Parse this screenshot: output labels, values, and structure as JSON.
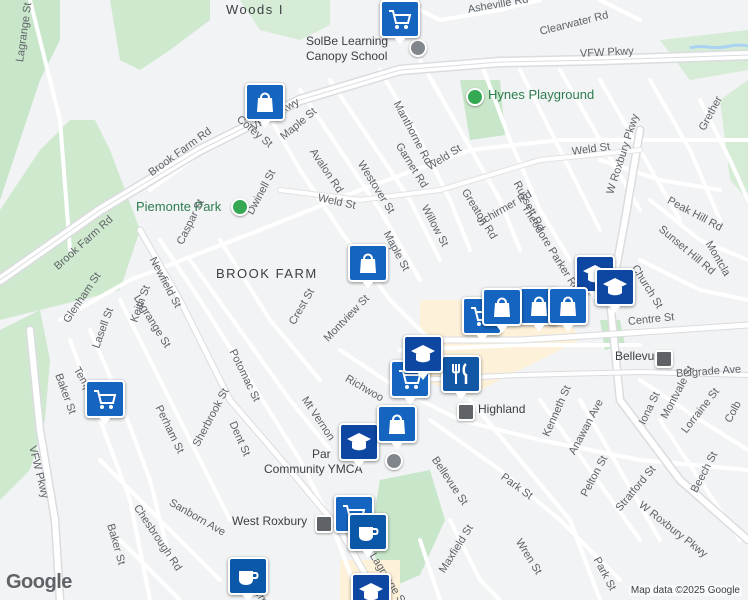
{
  "labels": {
    "areas": [
      "Woods I",
      "BROOK FARM"
    ],
    "parks": [
      "Piemonte Park",
      "Hynes Playground"
    ],
    "pois": [
      "SolBe Learning",
      "Canopy School",
      "Community YMCA",
      "Par"
    ],
    "stations": [
      "Bellevue",
      "Highland",
      "West Roxbury"
    ],
    "streets": {
      "vfw_pkwy_top": "VFW Pkwy",
      "vfw_pkwy_left": "VFW Pkwy",
      "vfw_pkwy_lower": "VFW Pkwy",
      "asheville": "Asheville Rd",
      "clearwater": "Clearwater Rd",
      "grether": "Grether",
      "manthorne": "Manthorne Rd",
      "garnet": "Garnet Rd",
      "westover": "Westover St",
      "weld_left": "Weld St",
      "weld_mid": "Weld St",
      "weld_right": "Weld St",
      "corey": "Corey St",
      "maple_top": "Maple St",
      "avalon": "Avalon Rd",
      "brook_farm_top": "Brook Farm Rd",
      "brook_farm_left": "Brook Farm Rd",
      "lagrange_top": "Lagrange St",
      "lagrange_mid": "Lagrange St",
      "lagrange_bottom": "Lagrange St",
      "dwinell": "Dwinell St",
      "caspar": "Caspar St",
      "newfield": "Newfield St",
      "keith": "Keith St",
      "glenham": "Glenham St",
      "lasell": "Lasell St",
      "temple_left": "Temple St",
      "temple_bottom": "Temple",
      "baker_left": "Baker St",
      "baker_bottom": "Baker St",
      "greaton": "Greaton Rd",
      "russett": "Russett Rd",
      "theodore": "Theodore Parker Rd",
      "w_roxbury_top": "W Roxbury Pkwy",
      "w_roxbury_bottom": "W Roxbury Pkwy",
      "peak_hill": "Peak Hill Rd",
      "sunset_hill": "Sunset Hill Rd",
      "montclair": "Montcla",
      "willow": "Willow St",
      "schirmer": "Schirmer Rd",
      "maple_mid": "Maple St",
      "church": "Church St",
      "centre": "Centre St",
      "belgrade": "Belgrade Ave",
      "crest": "Crest St",
      "montview": "Montview St",
      "potomac": "Potomac St",
      "perham": "Perham St",
      "sherbrook": "Sherbrook St",
      "dent": "Dent St",
      "mt_vernon": "Mt Vernon",
      "richwood": "Richwoo",
      "kenneth": "Kenneth St",
      "anawan": "Anawan Ave",
      "iona": "Iona St",
      "montvale": "Montvale St",
      "lorraine": "Lorraine St",
      "colby": "Colb",
      "bellevue_st": "Bellevue St",
      "park": "Park St",
      "pelton": "Pelton St",
      "stratford": "Stratford St",
      "beech": "Beech St",
      "park_bottom": "Park St",
      "wren": "Wren St",
      "maxfield": "Maxfield St",
      "sanborn": "Sanborn Ave",
      "chesbrough": "Chesbrough Rd"
    }
  },
  "pins": [
    {
      "kind": "shop",
      "icon": "shopping-cart-icon"
    },
    {
      "kind": "shop",
      "icon": "shopping-bag-icon"
    },
    {
      "kind": "shop",
      "icon": "shopping-bag-icon"
    },
    {
      "kind": "shop",
      "icon": "shopping-cart-icon"
    },
    {
      "kind": "edu",
      "icon": "school-icon"
    },
    {
      "kind": "shop",
      "icon": "shopping-bag-icon"
    },
    {
      "kind": "edu",
      "icon": "school-icon"
    },
    {
      "kind": "shop",
      "icon": "shopping-cart-icon"
    },
    {
      "kind": "cafe",
      "icon": "coffee-cup-icon"
    },
    {
      "kind": "cafe",
      "icon": "coffee-cup-icon"
    },
    {
      "kind": "food",
      "icon": "restaurant-icon"
    },
    {
      "kind": "shop",
      "icon": "shopping-cart-icon"
    },
    {
      "kind": "shop",
      "icon": "shopping-bag-icon"
    },
    {
      "kind": "shop",
      "icon": "shopping-bag-icon"
    },
    {
      "kind": "shop",
      "icon": "shopping-cart-icon"
    },
    {
      "kind": "edu",
      "icon": "school-icon"
    },
    {
      "kind": "edu",
      "icon": "school-icon"
    },
    {
      "kind": "shop",
      "icon": "shopping-bag-icon"
    },
    {
      "kind": "edu",
      "icon": "school-icon"
    }
  ],
  "attribution": {
    "logo": "Google",
    "text": "Map data ©2025 Google"
  },
  "colors": {
    "land": "#f1f3f4",
    "park": "#c8e6c9",
    "road": "#ffffff",
    "major_road": "#dadce0",
    "pin_blue": "#1565c0",
    "commercial": "#fdf1d9"
  }
}
